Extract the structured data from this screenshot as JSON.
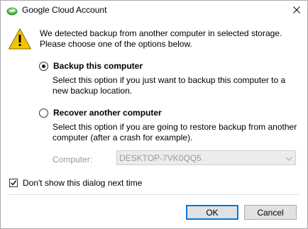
{
  "window": {
    "title": "Google Cloud Account",
    "app_icon": "cloud-app-icon",
    "close_icon": "close-icon"
  },
  "message": {
    "icon": "warning-icon",
    "text": "We detected backup from another computer in selected storage. Please choose one of the options below."
  },
  "options": [
    {
      "label": "Backup this computer",
      "description": "Select this option if you just want to backup this computer to a new backup location.",
      "selected": true
    },
    {
      "label": "Recover another computer",
      "description": "Select this option if you are going to restore backup from another computer (after a crash for example).",
      "selected": false
    }
  ],
  "computer": {
    "label": "Computer:",
    "value": "DESKTOP-7VK0QQ5",
    "enabled": false
  },
  "dont_show": {
    "label": "Don't show this dialog next time",
    "checked": true
  },
  "buttons": {
    "ok": "OK",
    "cancel": "Cancel"
  },
  "colors": {
    "accent": "#0078d7",
    "disabled_text": "#9a9a9a",
    "warning_fill": "#f5c400"
  }
}
